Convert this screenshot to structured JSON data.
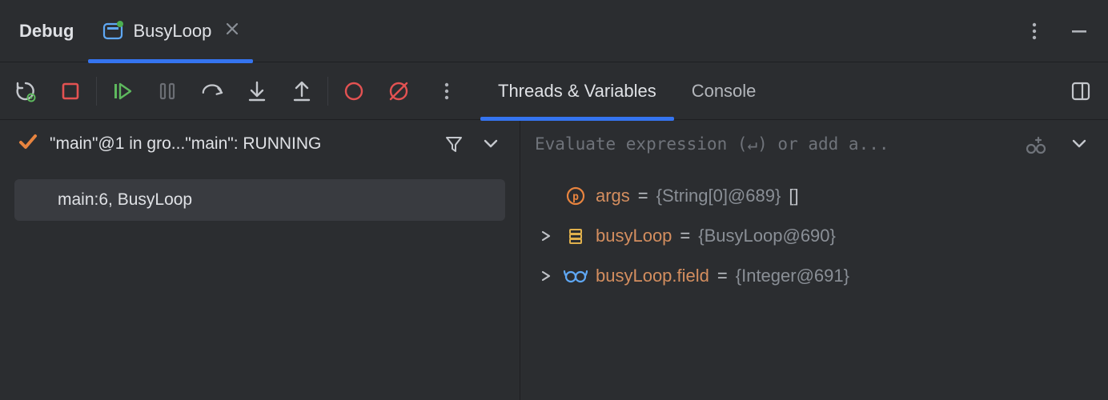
{
  "header": {
    "title": "Debug",
    "tab": {
      "label": "BusyLoop"
    }
  },
  "debugTabs": {
    "threads": "Threads & Variables",
    "console": "Console"
  },
  "frames": {
    "threadLabel": "\"main\"@1 in gro...\"main\": RUNNING",
    "stack": [
      {
        "label": "main:6, BusyLoop"
      }
    ]
  },
  "eval": {
    "placeholder": "Evaluate expression (↵) or add a..."
  },
  "variables": [
    {
      "kind": "param",
      "name": "args",
      "value": "{String[0]@689}",
      "extra": "[]",
      "expandable": false
    },
    {
      "kind": "object",
      "name": "busyLoop",
      "value": "{BusyLoop@690}",
      "expandable": true
    },
    {
      "kind": "watch",
      "name": "busyLoop.field",
      "value": "{Integer@691}",
      "expandable": true
    }
  ]
}
